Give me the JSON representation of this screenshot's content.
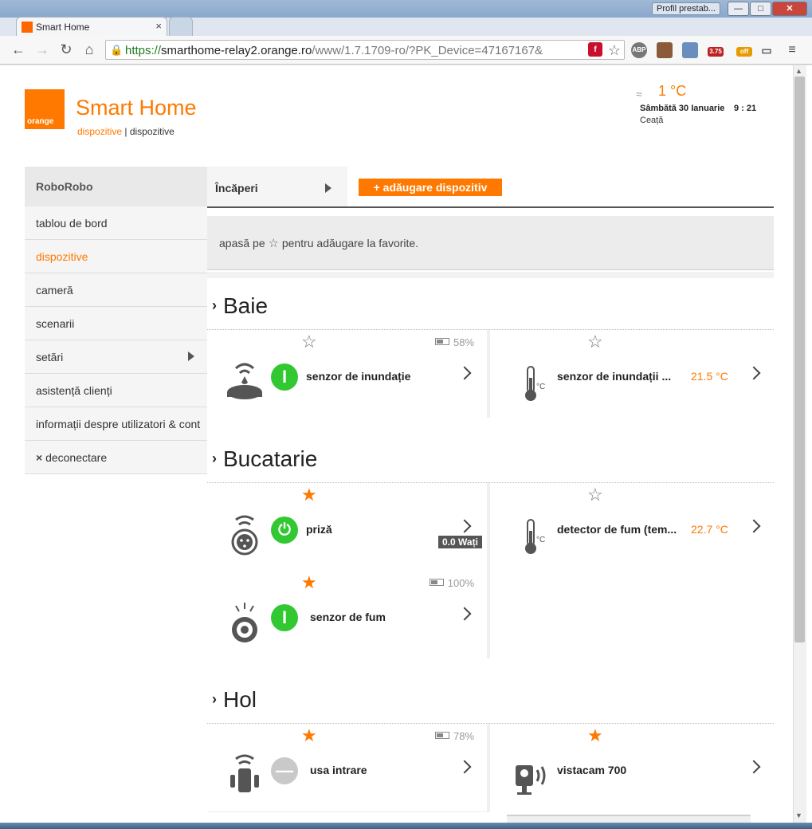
{
  "browser": {
    "tab_title": "Smart Home",
    "tab_close": "×",
    "profile_button": "Profil prestab...",
    "window_min": "—",
    "window_max": "□",
    "window_close": "✕",
    "url_scheme": "https://",
    "url_host": "smarthome-relay2.orange.ro",
    "url_path": "/www/1.7.1709-ro/?PK_Device=47167167&",
    "extensions": {
      "abp": "ABP",
      "badge_count": "3.75",
      "off_badge": "off"
    },
    "icons": [
      "back-icon",
      "forward-icon",
      "reload-icon",
      "home-icon",
      "lock-icon",
      "bookmark-star-icon",
      "menu-icon"
    ]
  },
  "header": {
    "logo_text": "orange",
    "app_title": "Smart Home",
    "breadcrumb_active": "dispozitive",
    "breadcrumb_sep": " | ",
    "breadcrumb_current": "dispozitive",
    "temperature": "1 °C",
    "date": "Sâmbătă 30 Ianuarie",
    "time": "9 : 21",
    "condition": "Ceață"
  },
  "sidebar": {
    "user": "RoboRobo",
    "items": [
      {
        "label": "tablou de bord"
      },
      {
        "label": "dispozitive"
      },
      {
        "label": "cameră"
      },
      {
        "label": "scenarii"
      },
      {
        "label": "setări"
      },
      {
        "label": "asistență clienți"
      },
      {
        "label": "informații despre utilizatori & cont"
      },
      {
        "label": "deconectare",
        "icon": "×"
      }
    ]
  },
  "toolbar": {
    "rooms_label": "Încăperi",
    "add_device": "+ adăugare dispozitiv",
    "hint_before": "apasă pe ",
    "hint_star": "☆",
    "hint_after": " pentru adăugare la favorite."
  },
  "rooms": [
    {
      "name": "Baie",
      "devices": [
        {
          "name": "senzor de inundație",
          "favorite": false,
          "battery": "58%",
          "state": "I"
        },
        {
          "name": "senzor de inundații ...",
          "favorite": false,
          "value": "21.5 °C"
        }
      ]
    },
    {
      "name": "Bucatarie",
      "devices": [
        {
          "name": "priză",
          "favorite": true,
          "state": "⏻",
          "power": "0.0 Wați"
        },
        {
          "name": "detector de fum (tem...",
          "favorite": false,
          "value": "22.7 °C"
        },
        {
          "name": "senzor de fum",
          "favorite": true,
          "battery": "100%",
          "state": "I"
        }
      ]
    },
    {
      "name": "Hol",
      "devices": [
        {
          "name": "usa intrare",
          "favorite": true,
          "battery": "78%",
          "state": "—"
        },
        {
          "name": "vistacam 700",
          "favorite": true
        }
      ]
    }
  ],
  "colors": {
    "brand": "#ff7900",
    "on": "#32c832",
    "neutral": "#c9c9c9"
  }
}
